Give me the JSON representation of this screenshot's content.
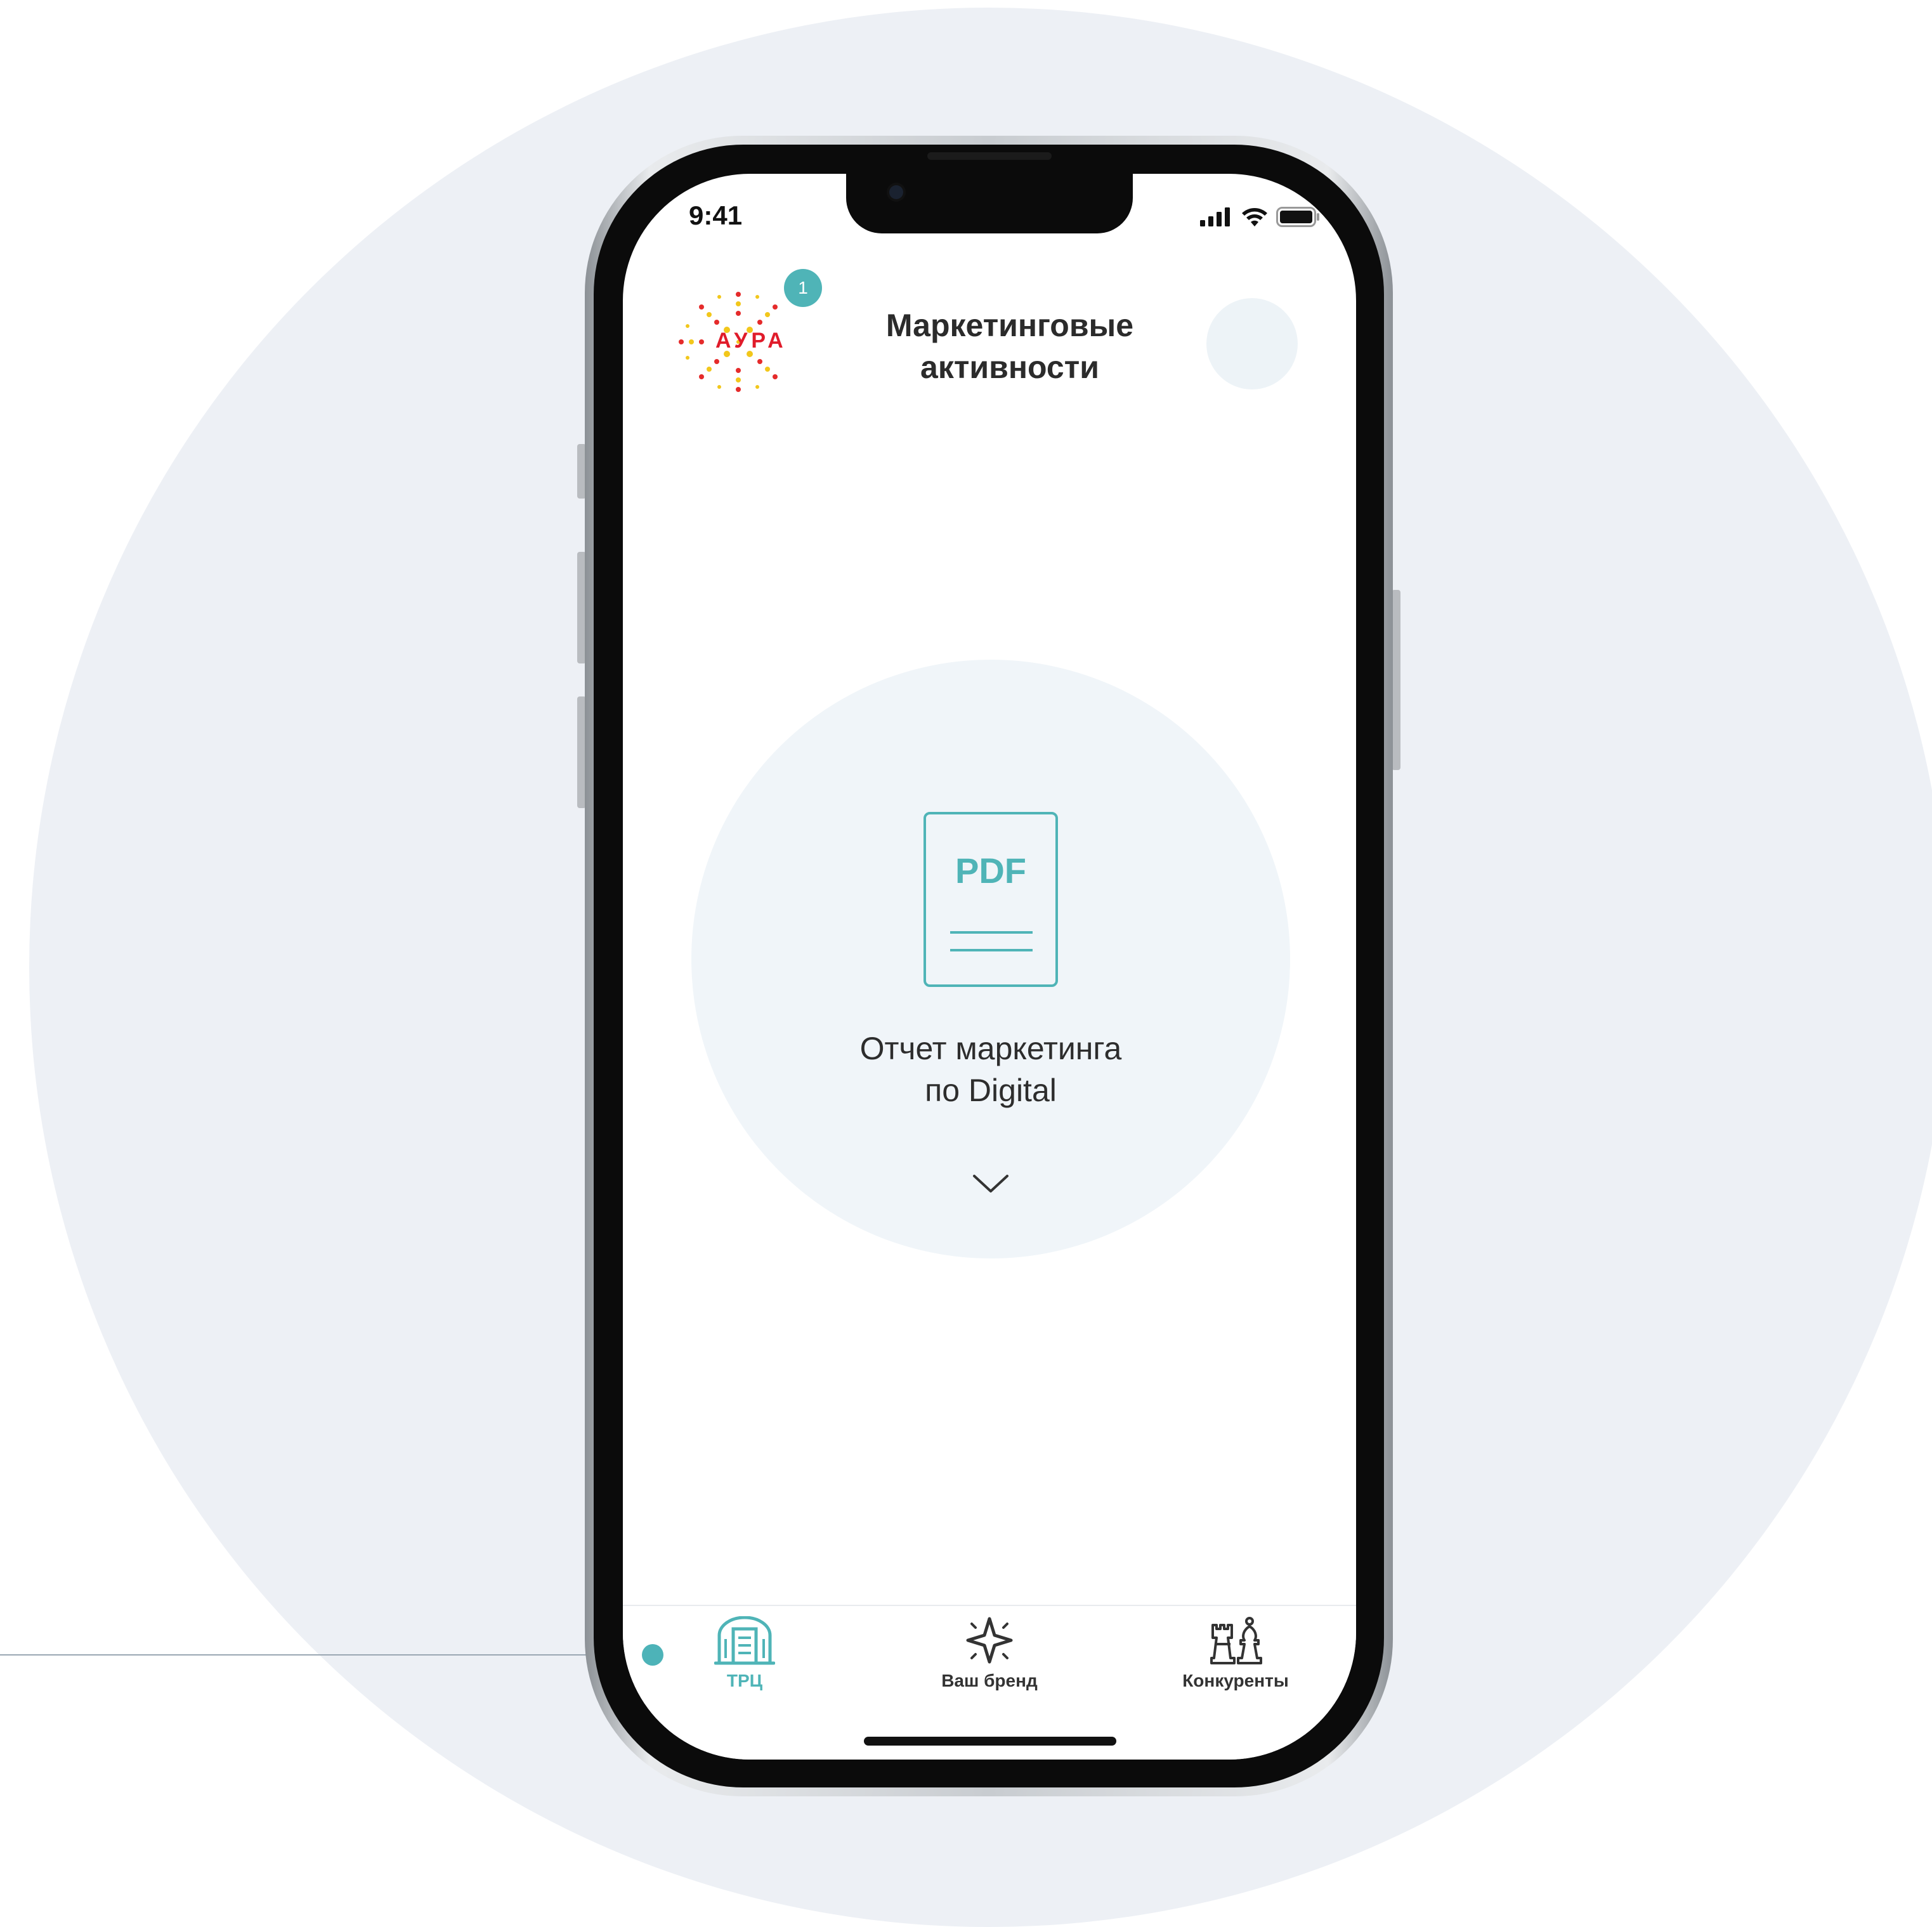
{
  "status_bar": {
    "time": "9:41"
  },
  "header": {
    "logo_text": "АУРА",
    "notification_count": "1",
    "title_line1": "Маркетинговые",
    "title_line2": "активности"
  },
  "report": {
    "icon_label": "PDF",
    "title_line1": "Отчет маркетинга",
    "title_line2": "по Digital"
  },
  "tabs": [
    {
      "label": "ТРЦ",
      "icon": "mall-building-icon",
      "active": true
    },
    {
      "label": "Ваш бренд",
      "icon": "sparkle-star-icon",
      "active": false
    },
    {
      "label": "Конкуренты",
      "icon": "chess-pieces-icon",
      "active": false
    }
  ],
  "colors": {
    "accent": "#4fb4b7",
    "background": "#edf0f5",
    "card": "#f0f5f9",
    "text": "#2b2b2b"
  }
}
